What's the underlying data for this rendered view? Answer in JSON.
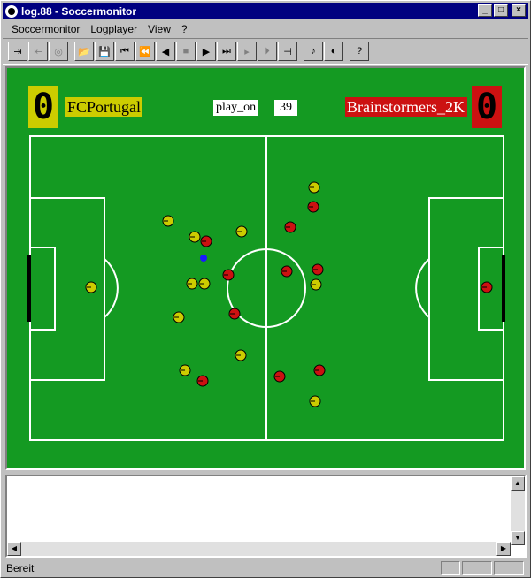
{
  "window": {
    "title": "log.88 - Soccermonitor"
  },
  "menu": [
    {
      "label": "Soccermonitor",
      "ul": "S"
    },
    {
      "label": "Logplayer",
      "ul": "L"
    },
    {
      "label": "View",
      "ul": "V"
    },
    {
      "label": "?",
      "ul": "?"
    }
  ],
  "toolbar": [
    {
      "name": "connect-icon",
      "glyph": "⇥",
      "enabled": true
    },
    {
      "name": "disconnect-icon",
      "glyph": "⇤",
      "enabled": false
    },
    {
      "name": "kickoff-icon",
      "glyph": "◎",
      "enabled": false
    },
    {
      "sep": true
    },
    {
      "name": "open-folder-icon",
      "glyph": "📂",
      "enabled": true
    },
    {
      "name": "save-icon",
      "glyph": "💾",
      "enabled": true
    },
    {
      "name": "rewind-start-icon",
      "glyph": "⏮",
      "enabled": true
    },
    {
      "name": "step-back-fast-icon",
      "glyph": "⏪",
      "enabled": true
    },
    {
      "name": "play-back-icon",
      "glyph": "◀",
      "enabled": true
    },
    {
      "name": "stop-icon",
      "glyph": "■",
      "enabled": false
    },
    {
      "name": "play-icon",
      "glyph": "▶",
      "enabled": true
    },
    {
      "name": "forward-end-icon",
      "glyph": "⏭",
      "enabled": true
    },
    {
      "name": "step-forward-icon",
      "glyph": "▸",
      "enabled": false
    },
    {
      "name": "step-forward-end-icon",
      "glyph": "⏵",
      "enabled": false
    },
    {
      "name": "jump-icon",
      "glyph": "⊣",
      "enabled": true
    },
    {
      "sep": true
    },
    {
      "name": "whistle-icon",
      "glyph": "♪",
      "enabled": true
    },
    {
      "name": "display-options-icon",
      "glyph": "◐",
      "enabled": true
    },
    {
      "sep": true
    },
    {
      "name": "help-icon",
      "glyph": "?",
      "enabled": true
    }
  ],
  "game": {
    "left_team": "FCPortugal",
    "right_team": "Brainstormers_2K",
    "left_score": "0",
    "right_score": "0",
    "play_mode": "play_on",
    "cycle": "39"
  },
  "colors": {
    "left_team": "#cccc00",
    "right_team": "#cc1111",
    "pitch": "#149a22",
    "ball": "#1a1aff"
  },
  "players_left": [
    [
      -198,
      -1
    ],
    [
      -111,
      -76
    ],
    [
      -81,
      -58
    ],
    [
      -84,
      -5
    ],
    [
      -70,
      -5
    ],
    [
      -99,
      33
    ],
    [
      -28,
      -64
    ],
    [
      -29,
      76
    ],
    [
      -92,
      93
    ],
    [
      54,
      -114
    ],
    [
      56,
      -4
    ],
    [
      55,
      128
    ]
  ],
  "players_right": [
    [
      -68,
      -53
    ],
    [
      -43,
      -15
    ],
    [
      -36,
      29
    ],
    [
      -72,
      105
    ],
    [
      27,
      -69
    ],
    [
      53,
      -92
    ],
    [
      23,
      -19
    ],
    [
      58,
      -21
    ],
    [
      15,
      100
    ],
    [
      60,
      93
    ],
    [
      249,
      -1
    ]
  ],
  "ball": [
    -71,
    -34
  ],
  "status": {
    "text": "Bereit"
  }
}
